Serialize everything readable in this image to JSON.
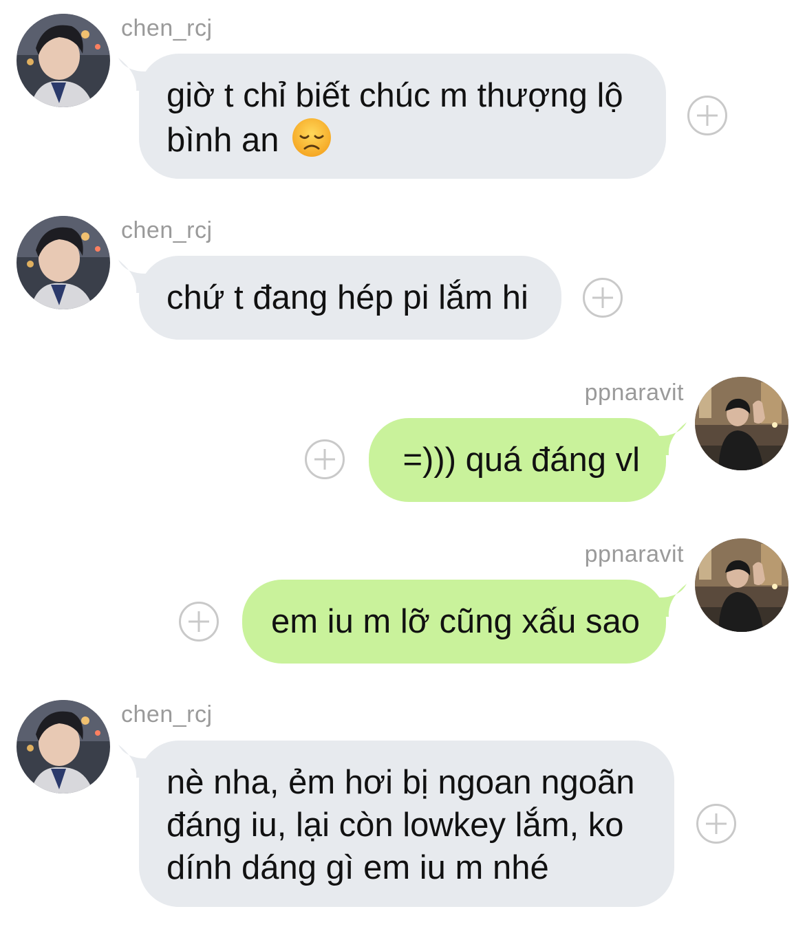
{
  "chat": {
    "messages": [
      {
        "sender": "chen_rcj",
        "direction": "incoming",
        "lines": [
          "giờ t chỉ biết chúc m thượng lộ",
          "bình an"
        ],
        "emoji": "disappointed-face-emoji"
      },
      {
        "sender": "chen_rcj",
        "direction": "incoming",
        "lines": [
          "chứ t đang hép pi lắm hi"
        ]
      },
      {
        "sender": "ppnaravit",
        "direction": "outgoing",
        "lines": [
          "=))) quá đáng vl"
        ]
      },
      {
        "sender": "ppnaravit",
        "direction": "outgoing",
        "lines": [
          "em iu m lỡ cũng xấu sao"
        ]
      },
      {
        "sender": "chen_rcj",
        "direction": "incoming",
        "lines": [
          "nè nha, ẻm hơi bị ngoan ngoãn",
          "đáng iu, lại còn lowkey lắm, ko",
          "dính dáng gì em iu m nhé"
        ]
      }
    ]
  },
  "colors": {
    "incoming_bubble": "#e7eaee",
    "outgoing_bubble": "#c9f29b",
    "sender_name": "#9a9a9a",
    "reaction_button": "#c9c9c9"
  }
}
